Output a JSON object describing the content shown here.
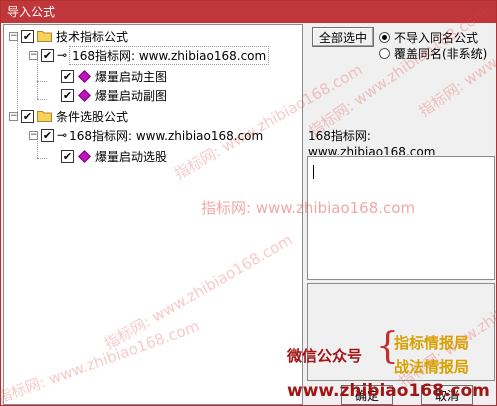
{
  "window": {
    "title": "导入公式"
  },
  "tree": {
    "root1": {
      "label": "技术指标公式",
      "checked": true
    },
    "group1": {
      "label": "168指标网: www.zhibiao168.com",
      "checked": true
    },
    "item1": {
      "label": "爆量启动主图",
      "checked": true
    },
    "item2": {
      "label": "爆量启动副图",
      "checked": true
    },
    "root2": {
      "label": "条件选股公式",
      "checked": true
    },
    "group2": {
      "label": "168指标网: www.zhibiao168.com",
      "checked": true
    },
    "item3": {
      "label": "爆量启动选股",
      "checked": true
    }
  },
  "controls": {
    "select_all": "全部选中",
    "radio1": "不导入同名公式",
    "radio2": "覆盖同名(非系统)",
    "selected_radio": "radio1"
  },
  "info": {
    "label": "168指标网:",
    "value": "www.zhibiao168.com"
  },
  "buttons": {
    "ok": "确定",
    "cancel": "取消"
  },
  "watermark": {
    "text": "指标网: www.zhibiao168.com"
  },
  "promo": {
    "wechat": "微信公众号",
    "line1": "指标情报局",
    "line2": "战法情报局",
    "url": "www.zhibiao168.com"
  },
  "colors": {
    "titlebar": "#c0373b",
    "item_icon": "#c010c0"
  },
  "icons": {
    "folder": "folder-icon",
    "key": "key-icon",
    "formula": "diamond-icon"
  }
}
